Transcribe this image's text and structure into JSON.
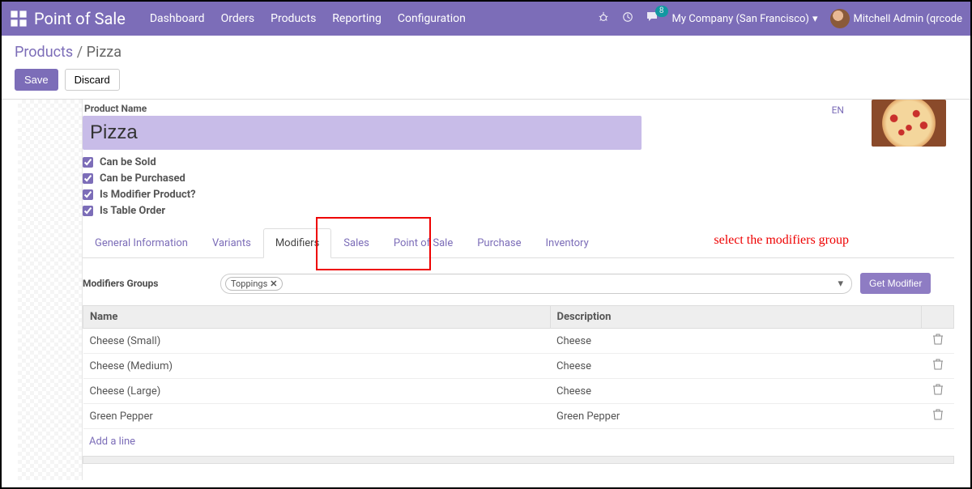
{
  "topbar": {
    "app_title": "Point of Sale",
    "nav": [
      "Dashboard",
      "Orders",
      "Products",
      "Reporting",
      "Configuration"
    ],
    "msg_badge": "8",
    "company": "My Company (San Francisco)",
    "user": "Mitchell Admin (qrcode"
  },
  "breadcrumb": {
    "root": "Products",
    "sep": "/",
    "current": "Pizza"
  },
  "actions": {
    "save": "Save",
    "discard": "Discard"
  },
  "product": {
    "name_label": "Product Name",
    "name_value": "Pizza",
    "lang_tag": "EN",
    "checks": {
      "can_be_sold": "Can be Sold",
      "can_be_purchased": "Can be Purchased",
      "is_modifier_product": "Is Modifier Product?",
      "is_table_order": "Is Table Order"
    }
  },
  "tabs": [
    "General Information",
    "Variants",
    "Modifiers",
    "Sales",
    "Point of Sale",
    "Purchase",
    "Inventory"
  ],
  "annotation_text": "select the modifiers group",
  "modifiers": {
    "groups_label": "Modifiers Groups",
    "tag": "Toppings",
    "get_btn": "Get Modifier",
    "columns": {
      "name": "Name",
      "description": "Description"
    },
    "rows": [
      {
        "name": "Cheese (Small)",
        "description": "Cheese"
      },
      {
        "name": "Cheese (Medium)",
        "description": "Cheese"
      },
      {
        "name": "Cheese (Large)",
        "description": "Cheese"
      },
      {
        "name": "Green Pepper",
        "description": "Green Pepper"
      }
    ],
    "add_line": "Add a line"
  }
}
